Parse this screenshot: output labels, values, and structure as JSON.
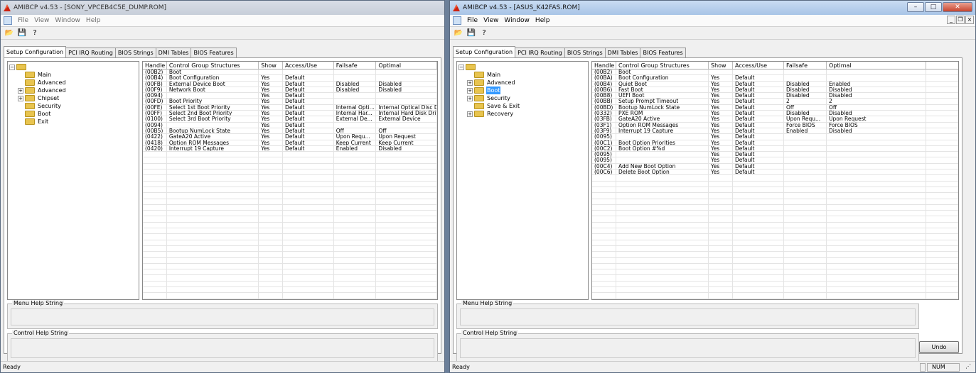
{
  "app": {
    "menu": [
      "File",
      "View",
      "Window",
      "Help"
    ],
    "tabs": [
      "Setup Configuration",
      "PCI IRQ Routing",
      "BIOS Strings",
      "DMI Tables",
      "BIOS Features"
    ],
    "columns": [
      "Handle",
      "Control Group Structures",
      "Show",
      "Access/Use",
      "Failsafe",
      "Optimal"
    ],
    "menu_help": "Menu Help String",
    "control_help": "Control Help String"
  },
  "win1": {
    "title": "AMIBCP v4.53 - [SONY_VPCEB4C5E_DUMP.ROM]",
    "status": "Ready",
    "tree": [
      "Main",
      "Advanced",
      "Advanced",
      "Chipset",
      "Security",
      "Boot",
      "Exit"
    ],
    "rows": [
      [
        "(00B2)",
        "Boot",
        "",
        "",
        "",
        ""
      ],
      [
        "(00B4)",
        "Boot Configuration",
        "Yes",
        "Default",
        "",
        ""
      ],
      [
        "(00FB)",
        "External Device Boot",
        "Yes",
        "Default",
        "Disabled",
        "Disabled"
      ],
      [
        "(00F9)",
        "Network Boot",
        "Yes",
        "Default",
        "Disabled",
        "Disabled"
      ],
      [
        "(0094)",
        "",
        "Yes",
        "Default",
        "",
        ""
      ],
      [
        "(00FD)",
        "Boot Priority",
        "Yes",
        "Default",
        "",
        ""
      ],
      [
        "(00FE)",
        "Select 1st Boot Priority",
        "Yes",
        "Default",
        "Internal Opti...",
        "Internal Optical Disc Drive"
      ],
      [
        "(00FF)",
        "Select 2nd Boot Priority",
        "Yes",
        "Default",
        "Internal Har...",
        "Internal Hard Disk Drive"
      ],
      [
        "(0100)",
        "Select 3rd Boot Priority",
        "Yes",
        "Default",
        "External De...",
        "External Device"
      ],
      [
        "(0094)",
        "",
        "Yes",
        "Default",
        "",
        ""
      ],
      [
        "(00B5)",
        "Bootup NumLock State",
        "Yes",
        "Default",
        "Off",
        "Off"
      ],
      [
        "(0422)",
        "GateA20 Active",
        "Yes",
        "Default",
        "Upon Requ...",
        "Upon Request"
      ],
      [
        "(0418)",
        "Option ROM Messages",
        "Yes",
        "Default",
        "Keep Current",
        "Keep Current"
      ],
      [
        "(0420)",
        "Interrupt 19 Capture",
        "Yes",
        "Default",
        "Enabled",
        "Disabled"
      ]
    ]
  },
  "win2": {
    "title": "AMIBCP v4.53 - [ASUS_K42FAS.ROM]",
    "status": "Ready",
    "status_num": "NUM",
    "undo": "Undo",
    "tree": [
      "Main",
      "Advanced",
      "Boot",
      "Security",
      "Save & Exit",
      "Recovery"
    ],
    "rows": [
      [
        "(00B2)",
        "Boot",
        "",
        "",
        "",
        ""
      ],
      [
        "(00BA)",
        "Boot Configuration",
        "Yes",
        "Default",
        "",
        ""
      ],
      [
        "(00B4)",
        "Quiet Boot",
        "Yes",
        "Default",
        "Disabled",
        "Enabled"
      ],
      [
        "(00B6)",
        "Fast Boot",
        "Yes",
        "Default",
        "Disabled",
        "Disabled"
      ],
      [
        "(00B8)",
        "UEFI Boot",
        "Yes",
        "Default",
        "Disabled",
        "Disabled"
      ],
      [
        "(00BB)",
        "Setup Prompt Timeout",
        "Yes",
        "Default",
        "2",
        "2"
      ],
      [
        "(00BD)",
        "Bootup NumLock State",
        "Yes",
        "Default",
        "Off",
        "Off"
      ],
      [
        "(0332)",
        "PXE ROM",
        "Yes",
        "Default",
        "Disabled",
        "Disabled"
      ],
      [
        "(03FB)",
        "GateA20 Active",
        "Yes",
        "Default",
        "Upon Requ...",
        "Upon Request"
      ],
      [
        "(03F1)",
        "Option ROM Messages",
        "Yes",
        "Default",
        "Force BIOS",
        "Force BIOS"
      ],
      [
        "(03F9)",
        "Interrupt 19 Capture",
        "Yes",
        "Default",
        "Enabled",
        "Disabled"
      ],
      [
        "(0095)",
        "",
        "Yes",
        "Default",
        "",
        ""
      ],
      [
        "(00C1)",
        "Boot Option Priorities",
        "Yes",
        "Default",
        "",
        ""
      ],
      [
        "(00C2)",
        "Boot Option #%d",
        "Yes",
        "Default",
        "",
        ""
      ],
      [
        "(0095)",
        "",
        "Yes",
        "Default",
        "",
        ""
      ],
      [
        "(0095)",
        "",
        "Yes",
        "Default",
        "",
        ""
      ],
      [
        "(00C4)",
        "Add New Boot Option",
        "Yes",
        "Default",
        "",
        ""
      ],
      [
        "(00C6)",
        "Delete Boot Option",
        "Yes",
        "Default",
        "",
        ""
      ]
    ]
  }
}
